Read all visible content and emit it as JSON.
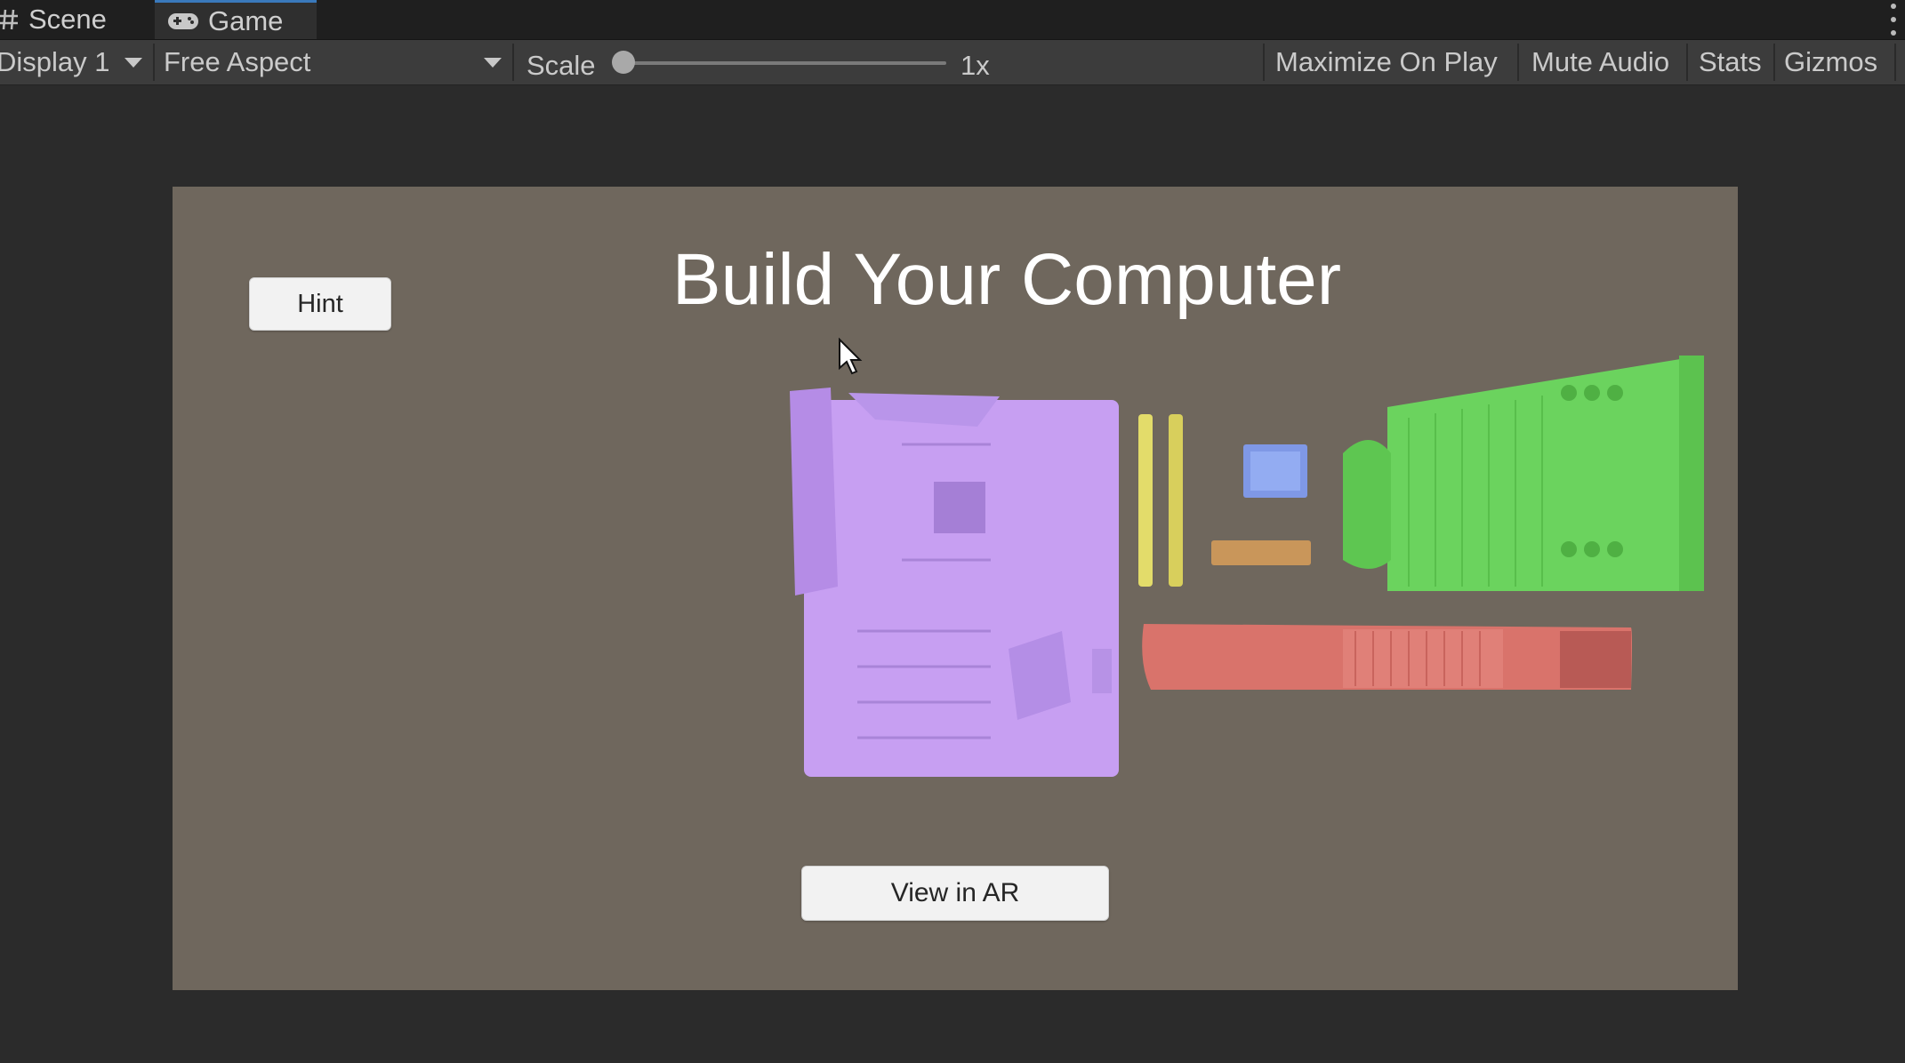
{
  "tabs": {
    "scene_label": "Scene",
    "game_label": "Game"
  },
  "toolbar": {
    "display": "Display 1",
    "aspect": "Free Aspect",
    "scale_label": "Scale",
    "scale_value": "1x",
    "maximize_on_play": "Maximize On Play",
    "mute_audio": "Mute Audio",
    "stats": "Stats",
    "gizmos": "Gizmos"
  },
  "game": {
    "title": "Build Your Computer",
    "hint_button": "Hint",
    "ar_button": "View in AR"
  },
  "colors": {
    "editor_bg": "#2b2b2b",
    "game_bg": "#6f675d",
    "motherboard": "#c79ff2",
    "ram": "#e3dc6a",
    "cpu": "#8aa4ee",
    "ssd": "#c9965a",
    "cooler": "#6bd35e",
    "gpu": "#d9736b"
  },
  "icons": [
    "scene-grid-icon",
    "game-controller-icon",
    "dropdown-arrow-icon",
    "more-options-icon",
    "mouse-cursor-icon"
  ]
}
